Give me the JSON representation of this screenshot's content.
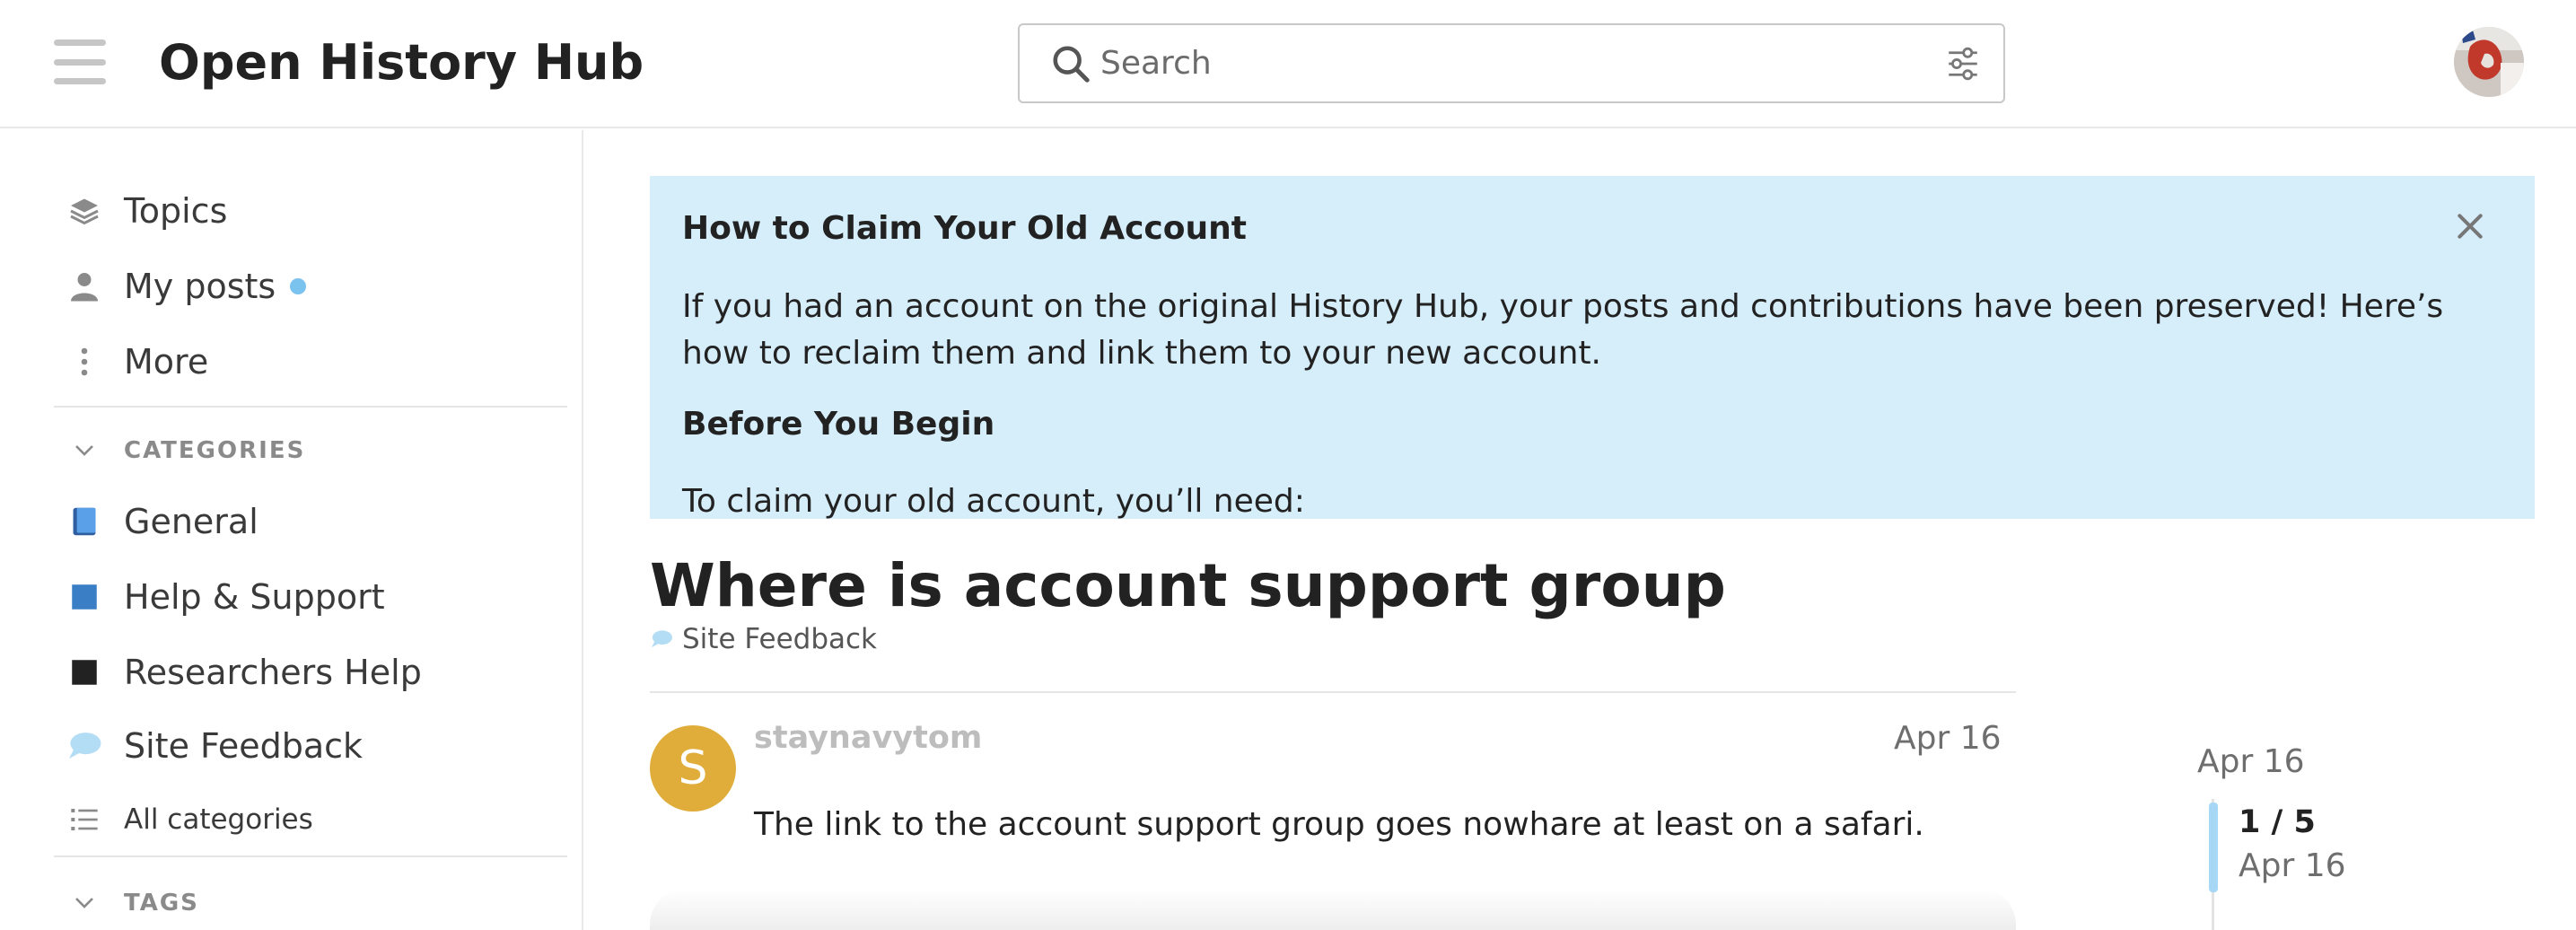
{
  "header": {
    "site_title": "Open History Hub",
    "search_placeholder": "Search"
  },
  "sidebar": {
    "items": [
      {
        "label": "Topics",
        "icon": "layers-icon"
      },
      {
        "label": "My posts",
        "icon": "user-icon",
        "has_unread_dot": true
      },
      {
        "label": "More",
        "icon": "vertical-ellipsis-icon"
      }
    ],
    "categories_heading": "CATEGORIES",
    "categories": [
      {
        "label": "General",
        "color": "#4a90e2"
      },
      {
        "label": "Help & Support",
        "color": "#3a7fc5"
      },
      {
        "label": "Researchers Help",
        "color": "#222222"
      },
      {
        "label": "Site Feedback",
        "color": "#b3dcf5"
      }
    ],
    "all_categories": "All categories",
    "tags_heading": "TAGS"
  },
  "banner": {
    "title": "How to Claim Your Old Account",
    "paragraph": "If you had an account on the original History Hub, your posts and contributions have been preserved! Here’s how to reclaim them and link them to your new account.",
    "subheading": "Before You Begin",
    "need_text": "To claim your old account, you’ll need:"
  },
  "topic": {
    "title": "Where is account support group",
    "category": "Site Feedback"
  },
  "post": {
    "avatar_letter": "S",
    "username": "staynavytom",
    "date": "Apr 16",
    "body": "The link to the account support group goes nowhare at least on a safari."
  },
  "timeline": {
    "top_date": "Apr 16",
    "position": "1 / 5",
    "current_date": "Apr 16"
  },
  "colors": {
    "banner_bg": "#d6edfa",
    "unread_dot": "#7ac3ef",
    "post_avatar": "#e0ad3a",
    "timeline_handle": "#a6d8f5"
  }
}
